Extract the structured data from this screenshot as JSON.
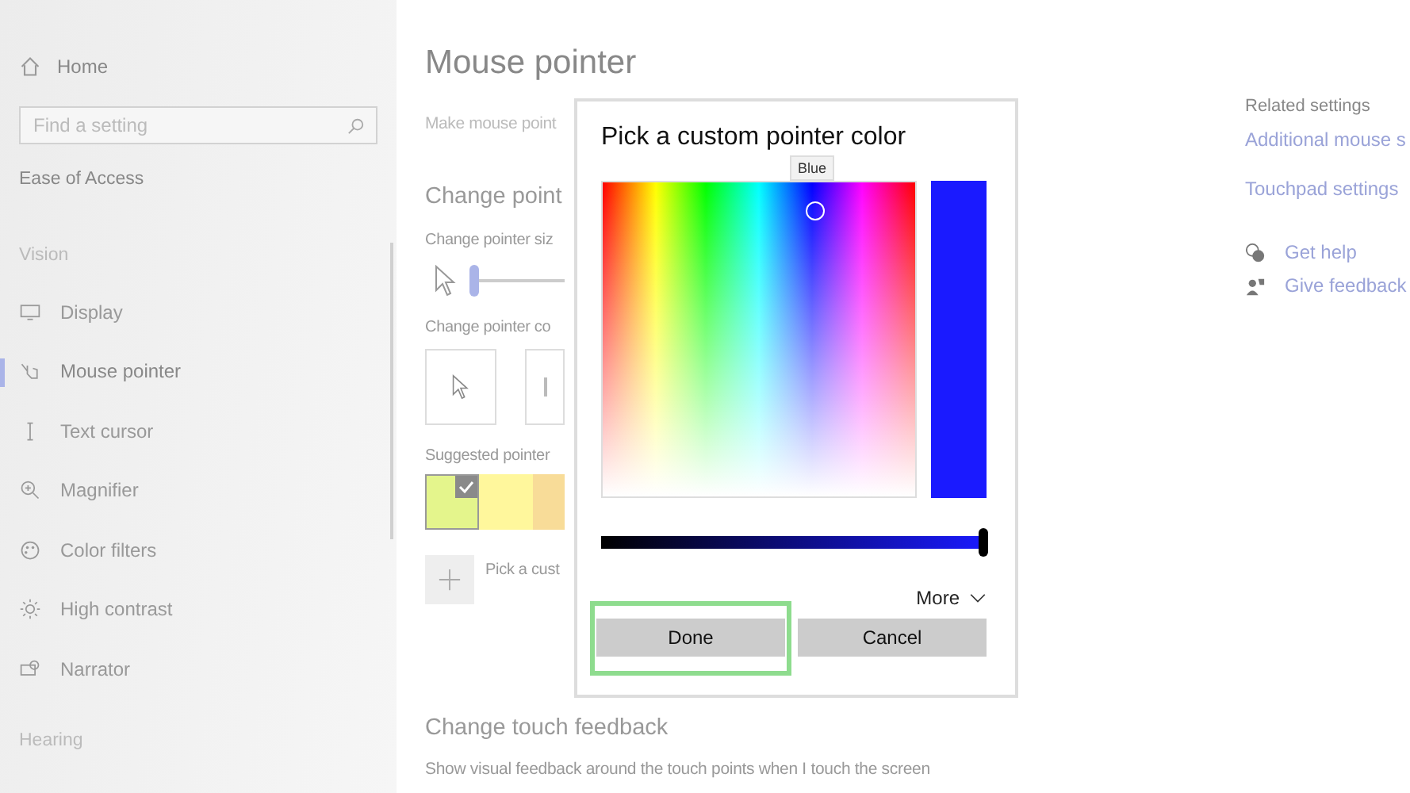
{
  "sidebar": {
    "home": "Home",
    "search": {
      "placeholder": "Find a setting"
    },
    "section": "Ease of Access",
    "groups": [
      {
        "heading": "Vision",
        "items": [
          {
            "label": "Display",
            "selected": false
          },
          {
            "label": "Mouse pointer",
            "selected": true
          },
          {
            "label": "Text cursor",
            "selected": false
          },
          {
            "label": "Magnifier",
            "selected": false
          },
          {
            "label": "Color filters",
            "selected": false
          },
          {
            "label": "High contrast",
            "selected": false
          },
          {
            "label": "Narrator",
            "selected": false
          }
        ]
      },
      {
        "heading": "Hearing"
      }
    ]
  },
  "main": {
    "title": "Mouse pointer",
    "intro": "Make mouse point",
    "section": "Change point",
    "size_label": "Change pointer siz",
    "size_slider": {
      "level": 0.0
    },
    "color_label": "Change pointer co",
    "suggested_label": "Suggested pointer",
    "swatches": [
      {
        "color": "#e4f58c",
        "selected": true
      },
      {
        "color": "#fff79c",
        "selected": false
      },
      {
        "color": "#f8dc98",
        "selected": false
      }
    ],
    "custom_label": "Pick a cust",
    "touch_heading": "Change touch feedback",
    "touch_text": "Show visual feedback around the touch points when I touch the screen"
  },
  "related": {
    "heading": "Related settings",
    "links": [
      "Additional mouse s",
      "Touchpad settings"
    ],
    "help": [
      "Get help",
      "Give feedback"
    ]
  },
  "dialog": {
    "title": "Pick a custom pointer color",
    "tooltip": "Blue",
    "brightness": {
      "level": 1.0
    },
    "more": "More",
    "buttons": [
      {
        "label": "Done",
        "highlighted": true
      },
      {
        "label": "Cancel",
        "highlighted": false
      }
    ]
  }
}
